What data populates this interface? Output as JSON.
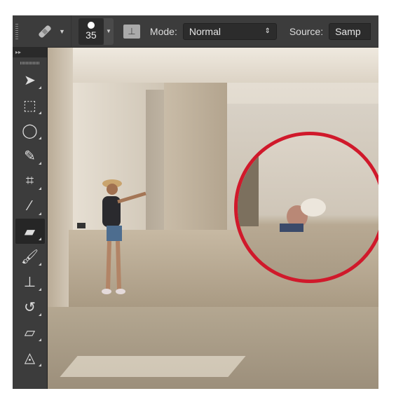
{
  "options_bar": {
    "tool_preset_icon": "spot-healing-brush-icon",
    "brush_size": "35",
    "mode_label": "Mode:",
    "mode_value": "Normal",
    "source_label": "Source:",
    "source_value": "Samp"
  },
  "toolbox": {
    "collapse_label": "▸▸",
    "tools": [
      {
        "name": "move-tool",
        "icon": "move-icon",
        "glyph": "➤"
      },
      {
        "name": "marquee-tool",
        "icon": "rectangular-marquee-icon",
        "glyph": "⬚"
      },
      {
        "name": "lasso-tool",
        "icon": "lasso-icon",
        "glyph": "◯"
      },
      {
        "name": "quick-selection-tool",
        "icon": "quick-selection-icon",
        "glyph": "✎"
      },
      {
        "name": "crop-tool",
        "icon": "crop-icon",
        "glyph": "⌗"
      },
      {
        "name": "eyedropper-tool",
        "icon": "eyedropper-icon",
        "glyph": "⁄"
      },
      {
        "name": "spot-healing-brush-tool",
        "icon": "bandage-icon",
        "glyph": "▰",
        "active": true
      },
      {
        "name": "brush-tool",
        "icon": "brush-icon",
        "glyph": "🖌"
      },
      {
        "name": "clone-stamp-tool",
        "icon": "stamp-icon",
        "glyph": "⊥"
      },
      {
        "name": "history-brush-tool",
        "icon": "history-brush-icon",
        "glyph": "↺"
      },
      {
        "name": "eraser-tool",
        "icon": "eraser-icon",
        "glyph": "▱"
      },
      {
        "name": "paint-bucket-tool",
        "icon": "paint-bucket-icon",
        "glyph": "◬"
      }
    ]
  },
  "colors": {
    "highlight_circle": "#d0192b",
    "ui_dark": "#3c3c3c"
  }
}
